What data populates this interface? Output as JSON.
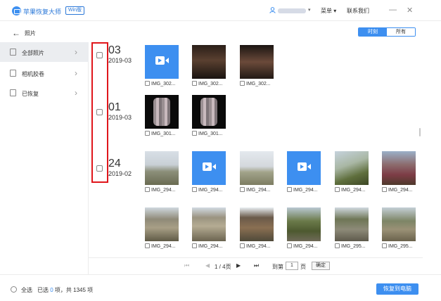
{
  "titlebar": {
    "app_title": "苹果恢复大师",
    "badge": "Win版",
    "menu": "菜单",
    "contact": "联系我们",
    "minimize": "—",
    "close": "✕"
  },
  "header": {
    "title": "照片",
    "tabs": [
      "时刻",
      "所有"
    ]
  },
  "sidebar": {
    "items": [
      {
        "label": "全部照片"
      },
      {
        "label": "相机胶卷"
      },
      {
        "label": "已恢复"
      }
    ]
  },
  "groups": [
    {
      "day": "03",
      "ym": "2019-03",
      "items": [
        {
          "type": "video",
          "caption": "IMG_302..."
        },
        {
          "type": "dark",
          "caption": "IMG_302..."
        },
        {
          "type": "dark2",
          "caption": "IMG_302..."
        }
      ]
    },
    {
      "day": "01",
      "ym": "2019-03",
      "items": [
        {
          "type": "person",
          "caption": "IMG_301..."
        },
        {
          "type": "person",
          "caption": "IMG_301..."
        }
      ]
    },
    {
      "day": "24",
      "ym": "2019-02",
      "items": [
        {
          "type": "land1",
          "caption": "IMG_294..."
        },
        {
          "type": "video",
          "caption": "IMG_294..."
        },
        {
          "type": "land2",
          "caption": "IMG_294..."
        },
        {
          "type": "video",
          "caption": "IMG_294..."
        },
        {
          "type": "tree1",
          "caption": "IMG_294..."
        },
        {
          "type": "blossom",
          "caption": "IMG_294..."
        },
        {
          "type": "rock1",
          "caption": "IMG_294..."
        },
        {
          "type": "rock2",
          "caption": "IMG_294..."
        },
        {
          "type": "gate",
          "caption": "IMG_294..."
        },
        {
          "type": "forest",
          "caption": "IMG_294..."
        },
        {
          "type": "path",
          "caption": "IMG_295..."
        },
        {
          "type": "hill",
          "caption": "IMG_295..."
        }
      ]
    }
  ],
  "pager": {
    "info": "1 / 4页",
    "goto_label": "到第",
    "page_value": "1",
    "page_suffix": "页",
    "confirm": "确定"
  },
  "footer": {
    "select_all": "全选",
    "selected_prefix": "已选",
    "selected_count": "0",
    "selected_suffix": "项，共 1345 项",
    "recover_button": "恢复到电脑"
  }
}
